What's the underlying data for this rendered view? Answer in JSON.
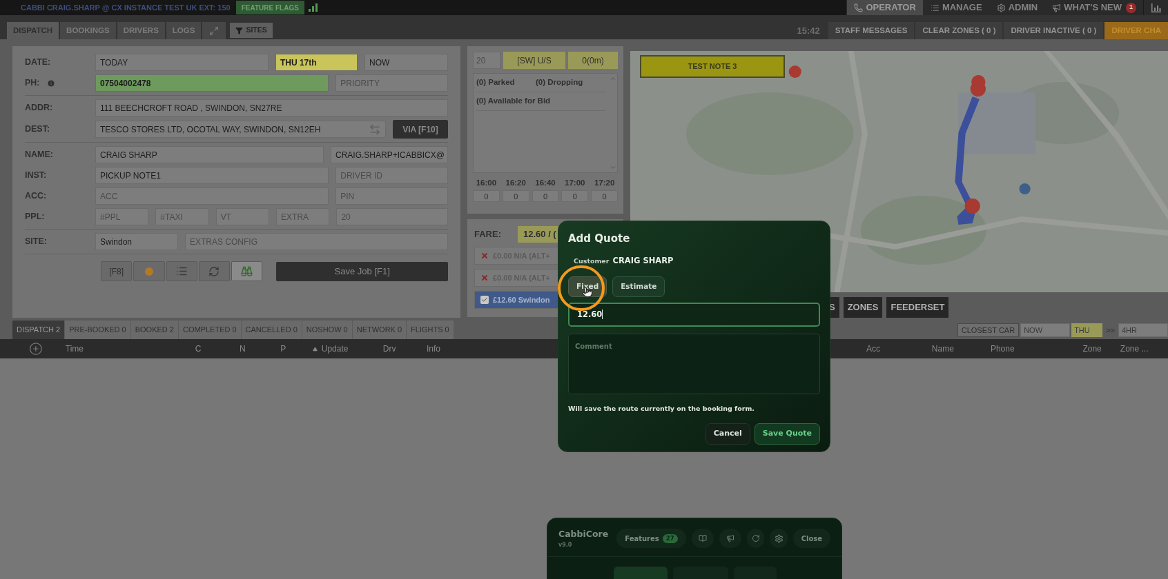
{
  "top_bar": {
    "title": "CABBI CRAIG.SHARP @ CX INSTANCE TEST UK EXT: 150",
    "flags_button": "FEATURE FLAGS"
  },
  "nav": [
    {
      "label": "OPERATOR",
      "selected": true
    },
    {
      "label": "MANAGE",
      "selected": false
    },
    {
      "label": "ADMIN",
      "selected": false
    },
    {
      "label": "WHAT'S NEW",
      "selected": false,
      "badge": "1"
    }
  ],
  "dispatch_tabs": [
    {
      "label": "DISPATCH",
      "selected": true
    },
    {
      "label": "BOOKINGS",
      "selected": false
    },
    {
      "label": "DRIVERS",
      "selected": false
    },
    {
      "label": "LOGS",
      "selected": false
    }
  ],
  "sites_button": "SITES",
  "clock": "15:42",
  "status_buttons": [
    {
      "label": "STAFF MESSAGES",
      "kind": "plain"
    },
    {
      "label": "CLEAR ZONES ( 0 )",
      "kind": "plain"
    },
    {
      "label": "DRIVER INACTIVE ( 0 )",
      "kind": "plain"
    },
    {
      "label": "DRIVER CHA",
      "kind": "alert"
    }
  ],
  "form": {
    "groups": [
      [
        {
          "label": "DATE:",
          "info": false,
          "fields": [
            {
              "value": "TODAY"
            },
            {
              "value": "THU 17th",
              "color": "#c9c55a"
            },
            {
              "value": "NOW"
            }
          ]
        },
        {
          "label": "PH:",
          "info": true,
          "fields": [
            {
              "value": "07504002478",
              "color": "#6e9a5e"
            },
            {
              "placeholder": "PRIORITY"
            }
          ]
        }
      ],
      [
        {
          "label": "ADDR:",
          "info": false,
          "fields": [
            {
              "value": "111 BEECHCROFT ROAD , SWINDON, SN27RE"
            }
          ]
        },
        {
          "label": "DEST:",
          "info": false,
          "fields": [
            {
              "value": "TESCO STORES LTD, OCOTAL WAY, SWINDON, SN12EH"
            }
          ],
          "button": "VIA [F10]"
        }
      ],
      [
        {
          "label": "NAME:",
          "info": false,
          "fields": [
            {
              "value": "CRAIG SHARP"
            },
            {
              "value": "CRAIG.SHARP+ICABBICX@"
            }
          ]
        },
        {
          "label": "INST:",
          "info": false,
          "fields": [
            {
              "value": "PICKUP NOTE1"
            },
            {
              "placeholder": "DRIVER ID"
            }
          ]
        },
        {
          "label": "ACC:",
          "info": false,
          "fields": [
            {
              "placeholder": "ACC"
            },
            {
              "placeholder": "PIN"
            }
          ]
        },
        {
          "label": "PPL:",
          "info": false,
          "fields": [
            {
              "placeholder": "#PPL"
            },
            {
              "placeholder": "#TAXI"
            },
            {
              "placeholder": "VT"
            },
            {
              "placeholder": "EXTRA"
            },
            {
              "placeholder": "20"
            }
          ]
        }
      ],
      [
        {
          "label": "SITE:",
          "info": false,
          "fields": [
            {
              "value": "Swindon"
            },
            {
              "placeholder": "EXTRAS CONFIG"
            }
          ]
        }
      ]
    ],
    "tools": [
      {
        "kind": "label",
        "label": "[F8]",
        "selected": false
      },
      {
        "kind": "record",
        "selected": false
      },
      {
        "kind": "list",
        "selected": false
      },
      {
        "kind": "refresh",
        "selected": false
      },
      {
        "kind": "binoculars",
        "selected": true
      }
    ],
    "save_button": "Save Job [F1]"
  },
  "availability": {
    "count": "20",
    "zone": "[SW] U/S",
    "eta": "0(0m)",
    "list": [
      {
        "cells": [
          "(0) Parked",
          "(0) Dropping"
        ]
      },
      {
        "cells": [
          "(0) Available for Bid"
        ]
      }
    ],
    "slots": [
      {
        "time": "16:00",
        "value": "0"
      },
      {
        "time": "16:20",
        "value": "0"
      },
      {
        "time": "16:40",
        "value": "0"
      },
      {
        "time": "17:00",
        "value": "0"
      },
      {
        "time": "17:20",
        "value": "0"
      }
    ]
  },
  "fare": {
    "label": "FARE:",
    "value": "12.60 / (",
    "options": [
      {
        "text": "£0.00 N/A (ALT+",
        "checked": false
      },
      {
        "text": "£0.00 N/A (ALT+",
        "checked": false
      },
      {
        "text": "£12.60 Swindon",
        "checked": true
      }
    ]
  },
  "map": {
    "note": "TEST NOTE 3",
    "buttons": [
      "S",
      "ZONES",
      "FEEDERSET"
    ]
  },
  "job_tabs": [
    {
      "label": "DISPATCH 2",
      "selected": true
    },
    {
      "label": "PRE-BOOKED 0",
      "selected": false
    },
    {
      "label": "BOOKED 2",
      "selected": false
    },
    {
      "label": "COMPLETED 0",
      "selected": false
    },
    {
      "label": "CANCELLED 0",
      "selected": false
    },
    {
      "label": "NOSHOW 0",
      "selected": false
    },
    {
      "label": "NETWORK 0",
      "selected": false
    },
    {
      "label": "FLIGHTS 0",
      "selected": false
    }
  ],
  "filters": [
    {
      "label": "CLOSEST CAR",
      "kind": "button"
    },
    {
      "label": "NOW",
      "kind": "field"
    },
    {
      "label": "THU",
      "kind": "day"
    },
    {
      "label": ">>",
      "kind": "text"
    },
    {
      "label": "4HR",
      "kind": "field"
    }
  ],
  "table": {
    "columns": [
      "Time",
      "C",
      "N",
      "P",
      "Update",
      "Drv",
      "Info",
      "Acc",
      "Name",
      "Phone",
      "Zone",
      "Zone ..."
    ]
  },
  "add_quote": {
    "title": "Add Quote",
    "customer_label": "Customer",
    "customer": "CRAIG SHARP",
    "types": [
      {
        "label": "Fixed",
        "selected": true
      },
      {
        "label": "Estimate",
        "selected": false
      }
    ],
    "amount": "12.60",
    "comment_placeholder": "Comment",
    "note": "Will save the route currently on the booking form.",
    "buttons": [
      {
        "label": "Cancel",
        "kind": "secondary"
      },
      {
        "label": "Save Quote",
        "kind": "primary"
      }
    ]
  },
  "cabbicore": {
    "title": "CabbiCore",
    "version": "v9.0",
    "features_label": "Features",
    "features_count": "27",
    "close": "Close"
  }
}
